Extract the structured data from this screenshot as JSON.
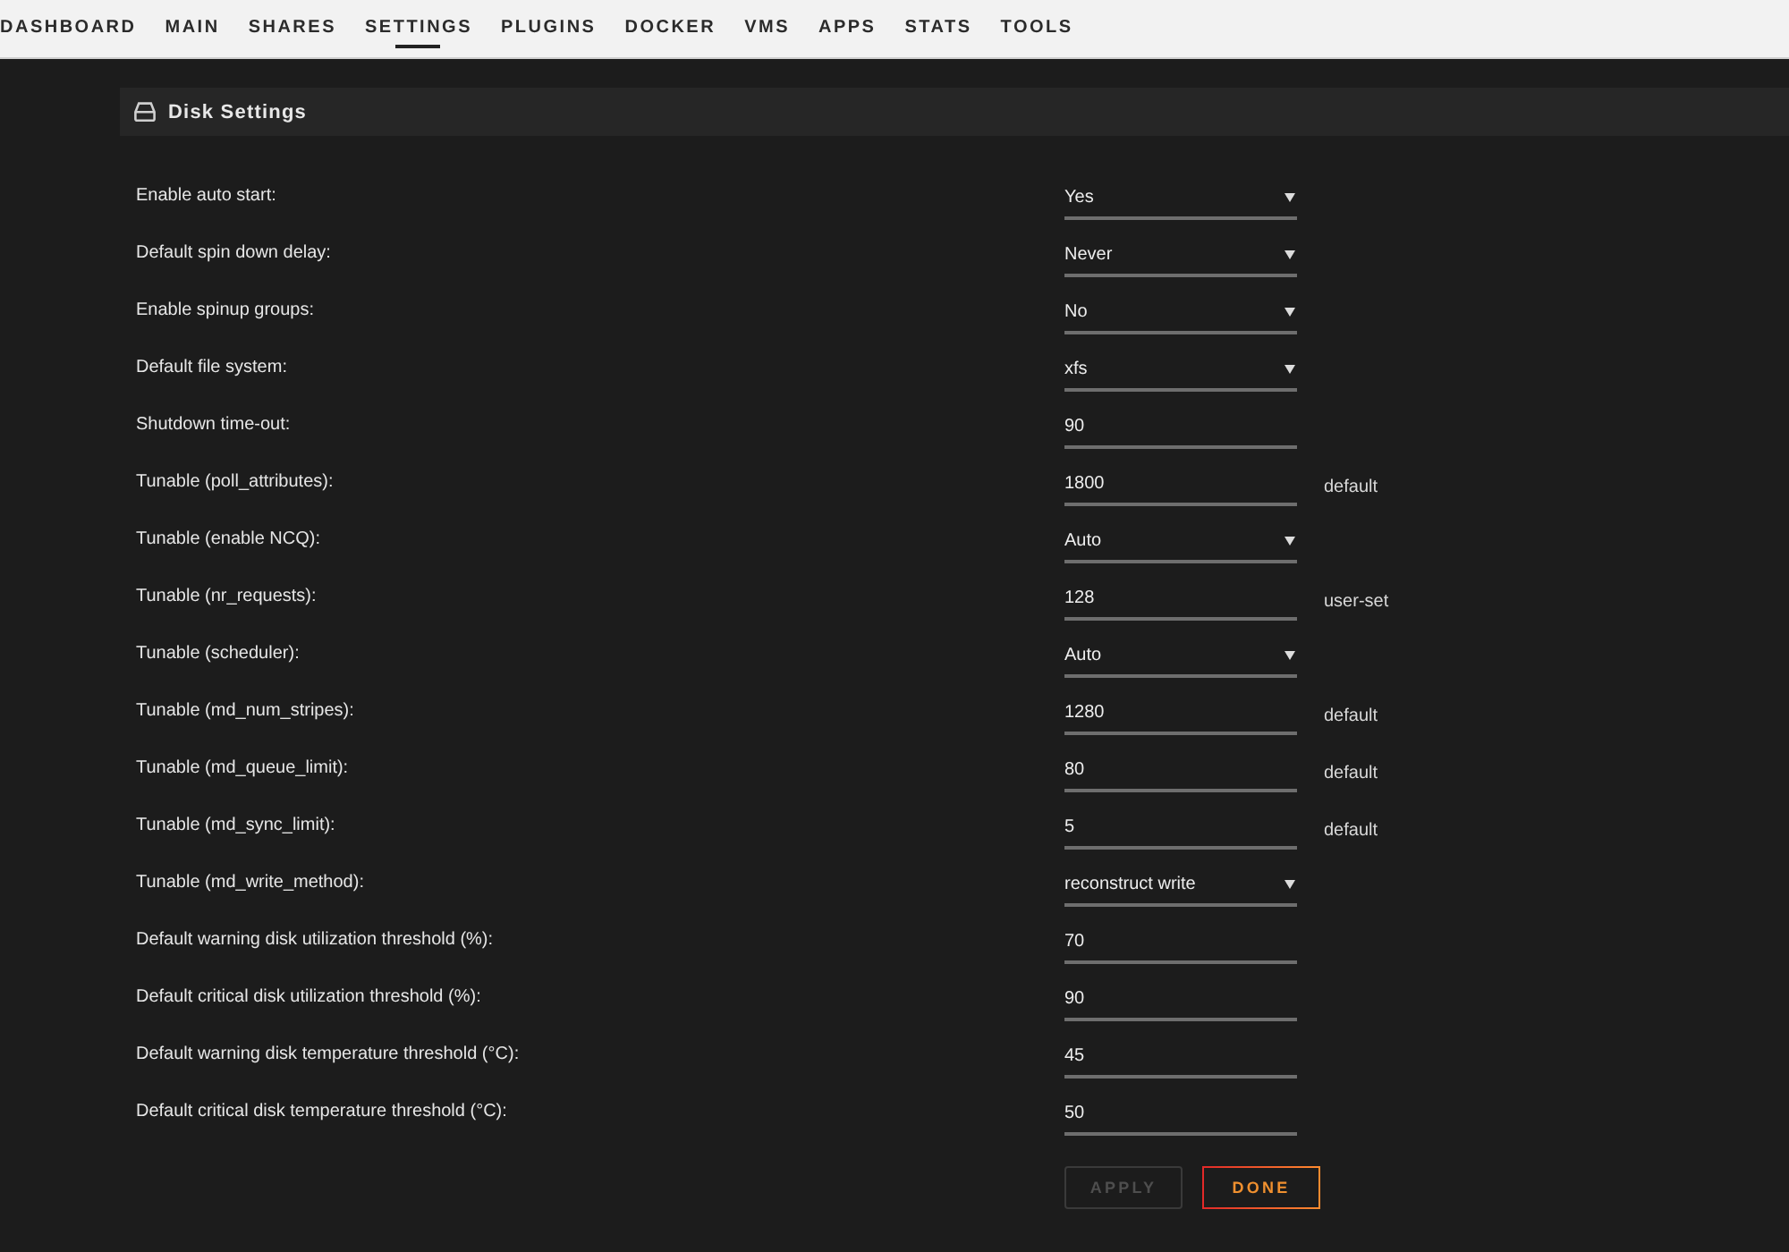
{
  "nav": {
    "items": [
      {
        "label": "DASHBOARD",
        "selected": false
      },
      {
        "label": "MAIN",
        "selected": false
      },
      {
        "label": "SHARES",
        "selected": false
      },
      {
        "label": "SETTINGS",
        "selected": true
      },
      {
        "label": "PLUGINS",
        "selected": false
      },
      {
        "label": "DOCKER",
        "selected": false
      },
      {
        "label": "VMS",
        "selected": false
      },
      {
        "label": "APPS",
        "selected": false
      },
      {
        "label": "STATS",
        "selected": false
      },
      {
        "label": "TOOLS",
        "selected": false
      }
    ]
  },
  "section": {
    "title": "Disk Settings"
  },
  "settings": [
    {
      "label": "Enable auto start:",
      "kind": "select",
      "value": "Yes"
    },
    {
      "label": "Default spin down delay:",
      "kind": "select",
      "value": "Never"
    },
    {
      "label": "Enable spinup groups:",
      "kind": "select",
      "value": "No"
    },
    {
      "label": "Default file system:",
      "kind": "select",
      "value": "xfs"
    },
    {
      "label": "Shutdown time-out:",
      "kind": "input",
      "value": "90"
    },
    {
      "label": "Tunable (poll_attributes):",
      "kind": "input",
      "value": "1800",
      "note": "default"
    },
    {
      "label": "Tunable (enable NCQ):",
      "kind": "select",
      "value": "Auto"
    },
    {
      "label": "Tunable (nr_requests):",
      "kind": "input",
      "value": "128",
      "note": "user-set"
    },
    {
      "label": "Tunable (scheduler):",
      "kind": "select",
      "value": "Auto"
    },
    {
      "label": "Tunable (md_num_stripes):",
      "kind": "input",
      "value": "1280",
      "note": "default"
    },
    {
      "label": "Tunable (md_queue_limit):",
      "kind": "input",
      "value": "80",
      "note": "default"
    },
    {
      "label": "Tunable (md_sync_limit):",
      "kind": "input",
      "value": "5",
      "note": "default"
    },
    {
      "label": "Tunable (md_write_method):",
      "kind": "select",
      "value": "reconstruct write"
    },
    {
      "label": "Default warning disk utilization threshold (%):",
      "kind": "input",
      "value": "70"
    },
    {
      "label": "Default critical disk utilization threshold (%):",
      "kind": "input",
      "value": "90"
    },
    {
      "label": "Default warning disk temperature threshold (°C):",
      "kind": "input",
      "value": "45"
    },
    {
      "label": "Default critical disk temperature threshold (°C):",
      "kind": "input",
      "value": "50"
    }
  ],
  "buttons": [
    {
      "label": "APPLY",
      "disabled": true
    },
    {
      "label": "DONE",
      "disabled": false
    }
  ]
}
